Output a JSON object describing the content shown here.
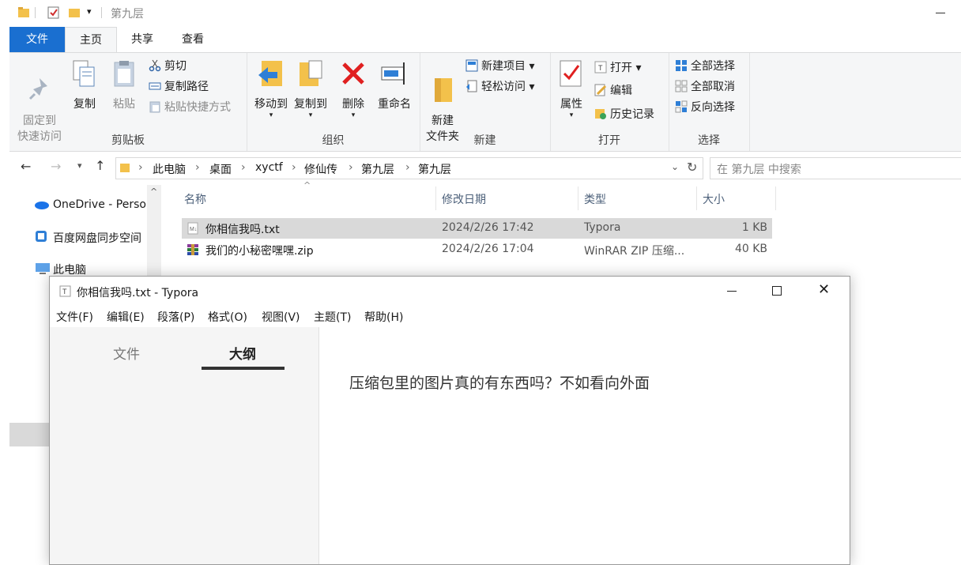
{
  "explorer": {
    "title": "第九层",
    "tabs": {
      "file": "文件",
      "home": "主页",
      "share": "共享",
      "view": "查看"
    },
    "ribbon": {
      "clipboard": {
        "label": "剪贴板",
        "pin": "固定到\n快速访问",
        "copy": "复制",
        "paste": "粘贴",
        "cut": "剪切",
        "copy_path": "复制路径",
        "paste_shortcut": "粘贴快捷方式"
      },
      "organize": {
        "label": "组织",
        "move_to": "移动到",
        "copy_to": "复制到",
        "delete": "删除",
        "rename": "重命名"
      },
      "new": {
        "label": "新建",
        "new_folder": "新建\n文件夹",
        "new_item": "新建项目",
        "easy_access": "轻松访问"
      },
      "open": {
        "label": "打开",
        "properties": "属性",
        "open": "打开",
        "edit": "编辑",
        "history": "历史记录"
      },
      "select": {
        "label": "选择",
        "select_all": "全部选择",
        "select_none": "全部取消",
        "invert": "反向选择"
      }
    },
    "breadcrumb": [
      "此电脑",
      "桌面",
      "xyctf",
      "修仙传",
      "第九层",
      "第九层"
    ],
    "search_placeholder": "在 第九层 中搜索",
    "nav": {
      "onedrive": "OneDrive - Perso",
      "baidu": "百度网盘同步空间",
      "this_pc": "此电脑"
    },
    "columns": {
      "name": "名称",
      "modified": "修改日期",
      "type": "类型",
      "size": "大小"
    },
    "files": [
      {
        "name": "你相信我吗.txt",
        "modified": "2024/2/26 17:42",
        "type": "Typora",
        "size": "1 KB"
      },
      {
        "name": "我们的小秘密嘿嘿.zip",
        "modified": "2024/2/26 17:04",
        "type": "WinRAR ZIP 压缩...",
        "size": "40 KB"
      }
    ]
  },
  "typora": {
    "title": "你相信我吗.txt - Typora",
    "menu": [
      "文件(F)",
      "编辑(E)",
      "段落(P)",
      "格式(O)",
      "视图(V)",
      "主题(T)",
      "帮助(H)"
    ],
    "sidebar_tabs": {
      "files": "文件",
      "outline": "大纲"
    },
    "content": "压缩包里的图片真的有东西吗？不如看向外面"
  },
  "colors": {
    "accent": "#1a6fd0",
    "selection": "#d9d9d9",
    "folder": "#f3c14b"
  }
}
